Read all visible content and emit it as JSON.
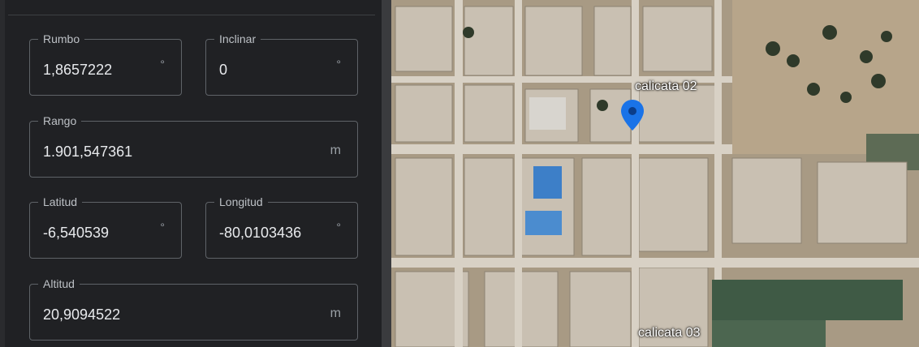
{
  "fields": {
    "rumbo": {
      "label": "Rumbo",
      "value": "1,8657222",
      "unit": "°"
    },
    "inclinar": {
      "label": "Inclinar",
      "value": "0",
      "unit": "°"
    },
    "rango": {
      "label": "Rango",
      "value": "1.901,547361",
      "unit": "m"
    },
    "latitud": {
      "label": "Latitud",
      "value": "-6,540539",
      "unit": "°"
    },
    "longitud": {
      "label": "Longitud",
      "value": "-80,0103436",
      "unit": "°"
    },
    "altitud": {
      "label": "Altitud",
      "value": "20,9094522",
      "unit": "m"
    }
  },
  "map": {
    "markers": [
      {
        "label": "calicata 02"
      },
      {
        "label": "calicata 03"
      }
    ],
    "pin_color": "#1a73e8"
  }
}
